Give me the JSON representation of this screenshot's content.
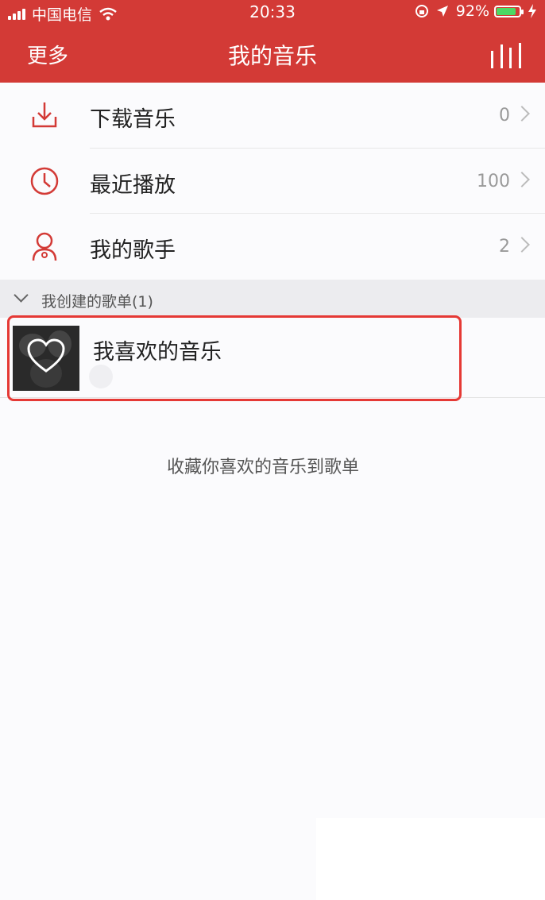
{
  "status_bar": {
    "carrier": "中国电信",
    "time": "20:33",
    "battery": "92%",
    "battery_level": 0.92
  },
  "nav": {
    "left_label": "更多",
    "title": "我的音乐",
    "right_icon": "equalizer-icon"
  },
  "colors": {
    "brand_red": "#d33a36",
    "highlight_red": "#e53935",
    "battery_green": "#4cd964"
  },
  "menu_items": [
    {
      "label": "下载音乐",
      "count": "0",
      "icon": "download-icon"
    },
    {
      "label": "最近播放",
      "count": "100",
      "icon": "clock-icon"
    },
    {
      "label": "我的歌手",
      "count": "2",
      "icon": "singer-icon"
    }
  ],
  "section": {
    "title": "我创建的歌单(1)"
  },
  "playlist": {
    "title": "我喜欢的音乐",
    "cover_icon": "heart-icon"
  },
  "empty_hint": "收藏你喜欢的音乐到歌单"
}
